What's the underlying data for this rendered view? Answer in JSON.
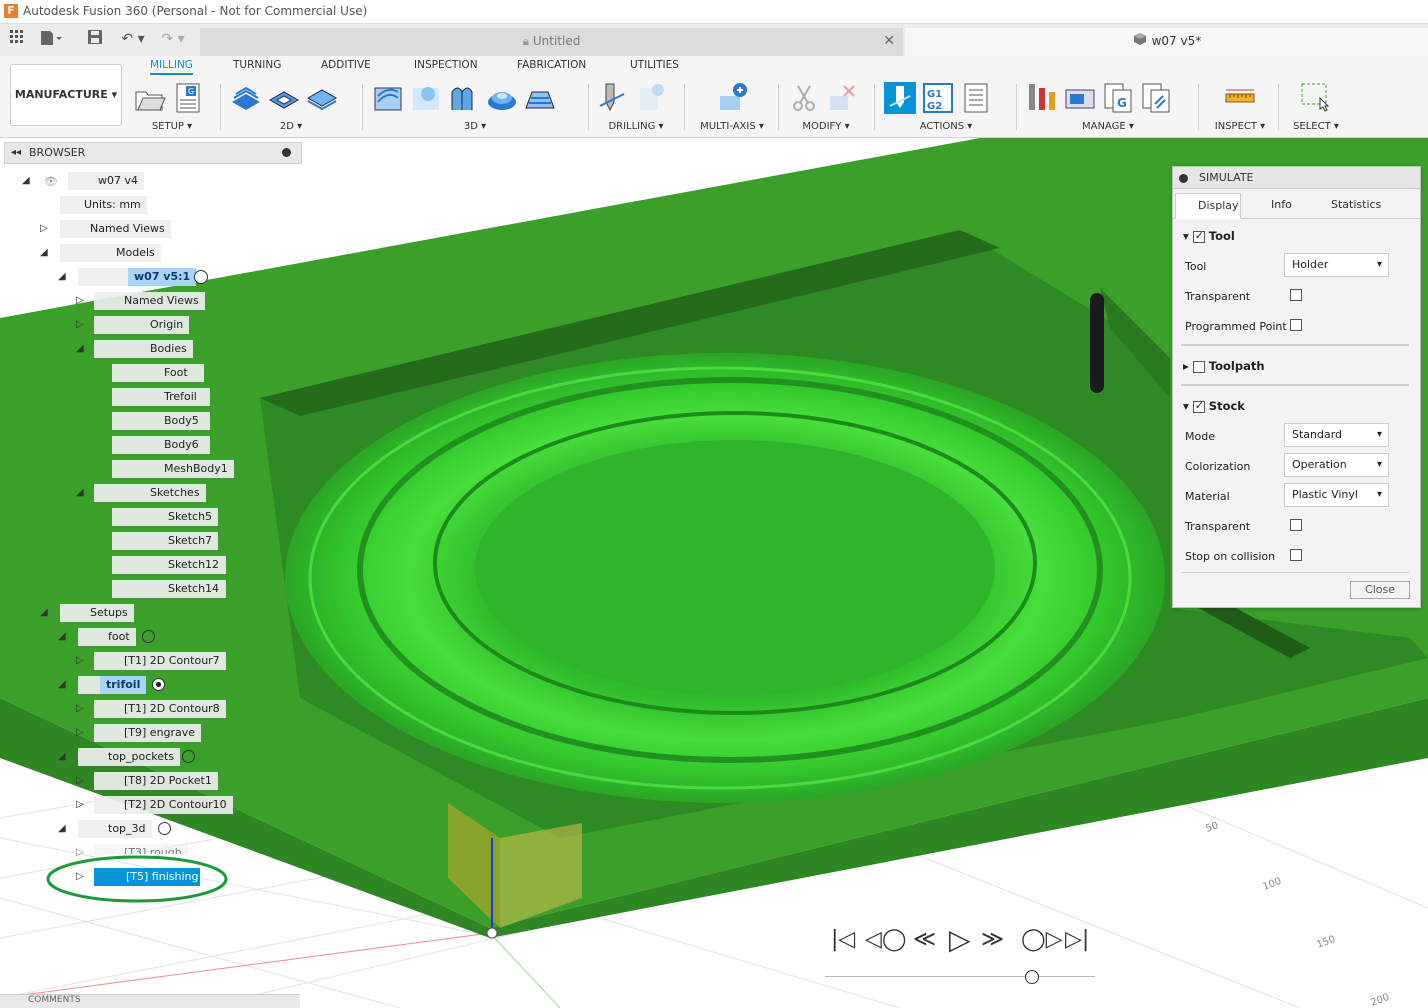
{
  "titlebar": {
    "title": "Autodesk Fusion 360 (Personal - Not for Commercial Use)",
    "logo": "F"
  },
  "tabs": {
    "untitled": "Untitled",
    "active_doc": "w07 v5*"
  },
  "ribbon": {
    "workspace": "MANUFACTURE ▾",
    "tabs": [
      "MILLING",
      "TURNING",
      "ADDITIVE",
      "INSPECTION",
      "FABRICATION",
      "UTILITIES"
    ],
    "groups": [
      "SETUP ▾",
      "2D ▾",
      "3D ▾",
      "DRILLING ▾",
      "MULTI-AXIS ▾",
      "MODIFY ▾",
      "ACTIONS ▾",
      "MANAGE ▾",
      "INSPECT ▾",
      "SELECT ▾"
    ]
  },
  "browser": {
    "title": "BROWSER",
    "root": "w07 v4",
    "units": "Units: mm",
    "named_views": "Named Views",
    "models": "Models",
    "component": "w07 v5:1",
    "comp_named_views": "Named Views",
    "origin": "Origin",
    "bodies": "Bodies",
    "body_items": [
      "Foot",
      "Trefoil",
      "Body5",
      "Body6",
      "MeshBody1"
    ],
    "sketches": "Sketches",
    "sketch_items": [
      "Sketch5",
      "Sketch7",
      "Sketch12",
      "Sketch14"
    ],
    "setups": "Setups",
    "setup_foot": "foot",
    "op_foot_1": "[T1] 2D Contour7",
    "setup_trifoil": "trifoil",
    "op_trifoil_1": "[T1] 2D Contour8",
    "op_trifoil_2": "[T9] engrave",
    "setup_top_pockets": "top_pockets",
    "op_tp_1": "[T8] 2D Pocket1",
    "op_tp_2": "[T2] 2D Contour10",
    "setup_top_3d": "top_3d",
    "op_3d_1": "[T3] rough",
    "op_3d_2": "[T5] finishing"
  },
  "simulate": {
    "title": "SIMULATE",
    "tabs": [
      "Display",
      "Info",
      "Statistics"
    ],
    "tool_section": "Tool",
    "tool_label": "Tool",
    "tool_value": "Holder",
    "transparent_label": "Transparent",
    "programmed_point": "Programmed Point",
    "toolpath_section": "Toolpath",
    "stock_section": "Stock",
    "mode_label": "Mode",
    "mode_value": "Standard",
    "colorization_label": "Colorization",
    "colorization_value": "Operation",
    "material_label": "Material",
    "material_value": "Plastic Vinyl",
    "stock_transparent": "Transparent",
    "stop_on_collision": "Stop on collision",
    "close": "Close"
  },
  "viewport": {
    "grid_labels": [
      "50",
      "100",
      "150",
      "200"
    ],
    "stock_color": "#3aa02a",
    "part_color": "#37d02b",
    "highlight_color": "#1a9b3b"
  },
  "comments": "COMMENTS"
}
